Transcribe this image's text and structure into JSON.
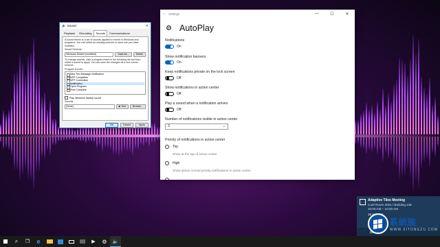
{
  "sound_dialog": {
    "title": "Sound",
    "close": "✕",
    "tabs": [
      "Playback",
      "Recording",
      "Sounds",
      "Communications"
    ],
    "active_tab": 2,
    "intro": "A sound theme is a set of sounds applied to events in Windows and programs. You can select an existing scheme or save one you have modified.",
    "scheme_label": "Sound Scheme:",
    "scheme_value": "Windows Default (modified)",
    "save_as": "Save As...",
    "delete": "Delete",
    "instructions": "To change sounds, click a program event in the following list and then select a sound to apply. You can save the changes as a new sound scheme.",
    "events_label": "Program Events:",
    "events": [
      "New Text Message Notification",
      "NFP Completion",
      "NFP Connection",
      "Notification",
      "Open Program",
      "Print Complete"
    ],
    "selected_event": 3,
    "startup_check": "Play Windows Startup sound",
    "sounds_label": "Sounds:",
    "sounds_value": "(None)",
    "test": "▶ Test",
    "browse": "Browse...",
    "ok": "OK",
    "cancel": "Cancel",
    "apply": "Apply"
  },
  "settings": {
    "window_title": "Settings",
    "back": "←",
    "minimize": "—",
    "maximize": "☐",
    "close": "✕",
    "gear": "⚙",
    "page_title": "AutoPlay",
    "notifications_label": "Notifications",
    "notifications_state": "On",
    "banners_label": "Show notification banners",
    "banners_state": "On",
    "lockscreen_label": "Keep notifications private on the lock screen",
    "lockscreen_state": "Off",
    "action_center_label": "Show notifications in action center",
    "action_center_state": "Off",
    "sound_label": "Play a sound when a notification arrives",
    "sound_state": "Off",
    "count_label": "Number of notifications visible in action center",
    "count_value": "3",
    "priority_label": "Priority of notifications in action center",
    "priority_top": "Top",
    "priority_top_desc": "Show at the top of action center",
    "priority_high": "High",
    "priority_high_desc": "Show above normal priority notifications in action center"
  },
  "toast": {
    "title": "Adaptive Tiles Meeting",
    "location": "Conf Room 2001 / Building 135",
    "time": "10:00 AM – 10:30 AM",
    "snooze": "15 minutes",
    "dismiss": "Dismiss"
  },
  "watermark": {
    "brand": "系统族",
    "url": "WWW.XITONGZU.COM"
  },
  "taskbar": {
    "search_icon": "⌕",
    "task_view_icon": "❐",
    "apps": [
      "edge",
      "explorer",
      "store",
      "mail",
      "photos",
      "media",
      "settings",
      "sound"
    ]
  },
  "colors": {
    "toggle_on": "#0067c0",
    "desktop_glow": "#e58cff",
    "toast_bg": "#1f3b5c",
    "taskbar_bg": "#1a1a1a"
  }
}
